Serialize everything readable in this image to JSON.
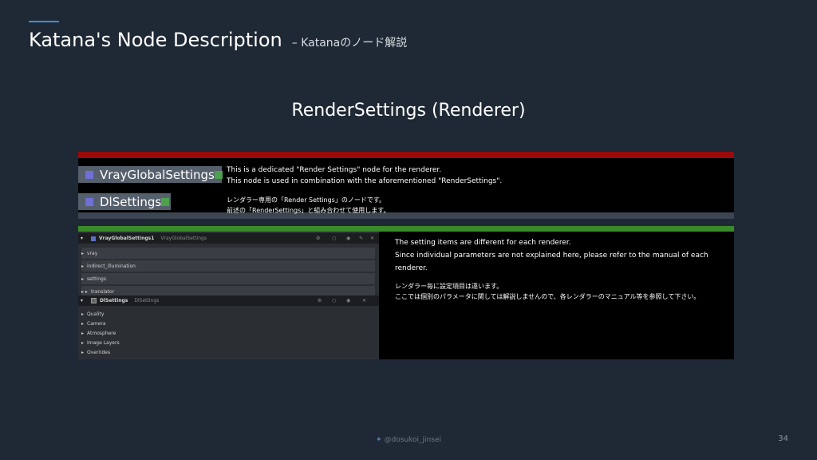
{
  "header": {
    "title": "Katana's Node Description",
    "subtitle": "– Katanaのノード解説"
  },
  "section_title": "RenderSettings (Renderer)",
  "nodes": {
    "vray": "VrayGlobalSettings",
    "dl": "DlSettings"
  },
  "top_desc": {
    "en_1": "This is a dedicated \"Render Settings\" node for the renderer.",
    "en_2": "This node is used in combination with the aforementioned \"RenderSettings\".",
    "jp_1": "レンダラー専用の「Render Settings」のノードです。",
    "jp_2": "前述の「RenderSettings」と組み合わせて使用します。"
  },
  "params": {
    "vray_header": "VrayGlobalSettings1",
    "vray_type": "VrayGlobalSettings",
    "vray_rows": [
      "vray",
      "indirect_illumination",
      "settings",
      "translator"
    ],
    "dl_header": "DlSettings",
    "dl_type": "DlSettings",
    "dl_rows": [
      "Quality",
      "Camera",
      "Atmosphere",
      "Image Layers",
      "Overrides"
    ]
  },
  "bottom_desc": {
    "en_1": "The setting items are different for each renderer.",
    "en_2": "Since individual parameters are not explained here, please refer to the manual of each renderer.",
    "jp_1": "レンダラー毎に設定項目は違います。",
    "jp_2": "ここでは個別のパラメータに関しては解説しませんので、各レンダラーのマニュアル等を参照して下さい。"
  },
  "footer": {
    "handle": "@dosukoi_jinsei",
    "page": "34"
  },
  "colors": {
    "accent": "#3d8fd6",
    "red_bar": "#9a0a0a",
    "green_bar": "#3a8a2a",
    "background": "#1f2935"
  }
}
